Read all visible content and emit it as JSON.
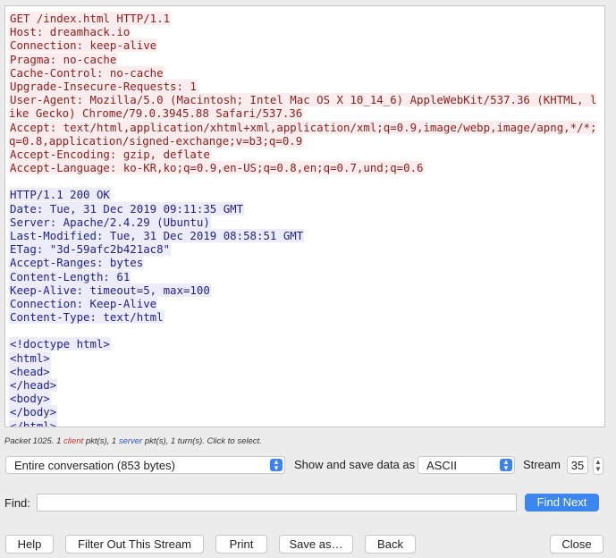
{
  "stream": {
    "client_request": [
      "GET /index.html HTTP/1.1",
      "Host: dreamhack.io",
      "Connection: keep-alive",
      "Pragma: no-cache",
      "Cache-Control: no-cache",
      "Upgrade-Insecure-Requests: 1",
      "User-Agent: Mozilla/5.0 (Macintosh; Intel Mac OS X 10_14_6) AppleWebKit/537.36 (KHTML, like Gecko) Chrome/79.0.3945.88 Safari/537.36",
      "Accept: text/html,application/xhtml+xml,application/xml;q=0.9,image/webp,image/apng,*/*;q=0.8,application/signed-exchange;v=b3;q=0.9",
      "Accept-Encoding: gzip, deflate",
      "Accept-Language: ko-KR,ko;q=0.9,en-US;q=0.8,en;q=0.7,und;q=0.6"
    ],
    "server_response": [
      "HTTP/1.1 200 OK",
      "Date: Tue, 31 Dec 2019 09:11:35 GMT",
      "Server: Apache/2.4.29 (Ubuntu)",
      "Last-Modified: Tue, 31 Dec 2019 08:58:51 GMT",
      "ETag: \"3d-59afc2b421ac8\"",
      "Accept-Ranges: bytes",
      "Content-Length: 61",
      "Keep-Alive: timeout=5, max=100",
      "Connection: Keep-Alive",
      "Content-Type: text/html"
    ],
    "server_body": [
      "<!doctype html>",
      "<html>",
      "<head>",
      "</head>",
      "<body>",
      "</body>",
      "</html>"
    ]
  },
  "packet_info": {
    "prefix": "Packet 1025. 1 ",
    "client_word": "client",
    "mid": " pkt(s), 1 ",
    "server_word": "server",
    "suffix": " pkt(s), 1 turn(s). Click to select."
  },
  "controls": {
    "conversation_select": "Entire conversation (853 bytes)",
    "show_save_label": "Show and save data as",
    "format_select": "ASCII",
    "stream_label": "Stream",
    "stream_value": "35"
  },
  "find": {
    "label": "Find:",
    "value": "",
    "find_next": "Find Next"
  },
  "buttons": {
    "help": "Help",
    "filter_out": "Filter Out This Stream",
    "print": "Print",
    "save_as": "Save as…",
    "back": "Back",
    "close": "Close"
  },
  "colors": {
    "client_bg": "#fbeded",
    "client_text": "#8b1d1d",
    "server_bg": "#ececfb",
    "server_text": "#1f1f8c",
    "accent": "#3c86f0"
  }
}
